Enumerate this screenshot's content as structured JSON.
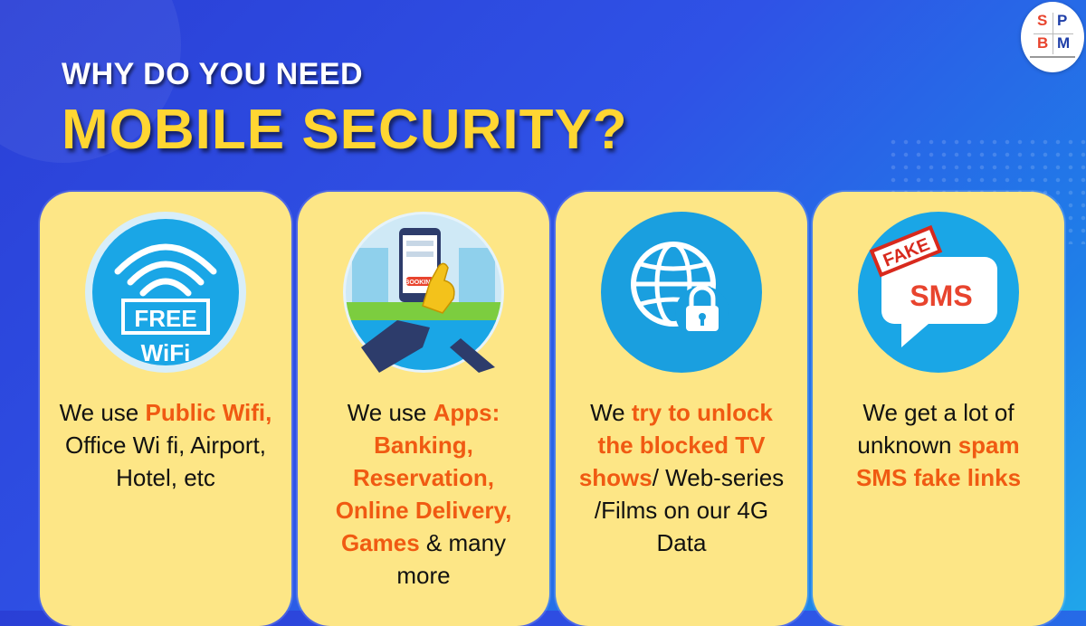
{
  "heading": {
    "line1": "WHY DO YOU NEED",
    "line2": "MOBILE SECURITY?"
  },
  "logo": {
    "letters": [
      "S",
      "P",
      "B",
      "M"
    ]
  },
  "colors": {
    "title_yellow": "#ffd632",
    "card_fill": "#fde686",
    "highlight_orange": "#f05a12",
    "icon_blue": "#1aa6e6"
  },
  "cards": [
    {
      "icon": "free-wifi-icon",
      "icon_text": {
        "line1": "FREE",
        "line2": "WiFi"
      },
      "parts": [
        {
          "t": "We use ",
          "hl": false
        },
        {
          "t": "Public Wifi,",
          "hl": true
        },
        {
          "t": " Office Wi fi, Airport, Hotel, etc",
          "hl": false
        }
      ]
    },
    {
      "icon": "mobile-booking-app-icon",
      "icon_text": {
        "line1": "BOOKING"
      },
      "parts": [
        {
          "t": "We use ",
          "hl": false
        },
        {
          "t": "Apps: Banking, Reservation, Online Delivery, Games",
          "hl": true
        },
        {
          "t": " & many more",
          "hl": false
        }
      ]
    },
    {
      "icon": "globe-lock-icon",
      "parts": [
        {
          "t": "We ",
          "hl": false
        },
        {
          "t": "try to unlock the blocked TV shows",
          "hl": true
        },
        {
          "t": "/ Web-series /Films on our 4G Data",
          "hl": false
        }
      ]
    },
    {
      "icon": "fake-sms-icon",
      "icon_text": {
        "stamp": "FAKE",
        "bubble": "SMS"
      },
      "parts": [
        {
          "t": "We get a lot of unknown ",
          "hl": false
        },
        {
          "t": "spam SMS fake links",
          "hl": true
        }
      ]
    }
  ]
}
